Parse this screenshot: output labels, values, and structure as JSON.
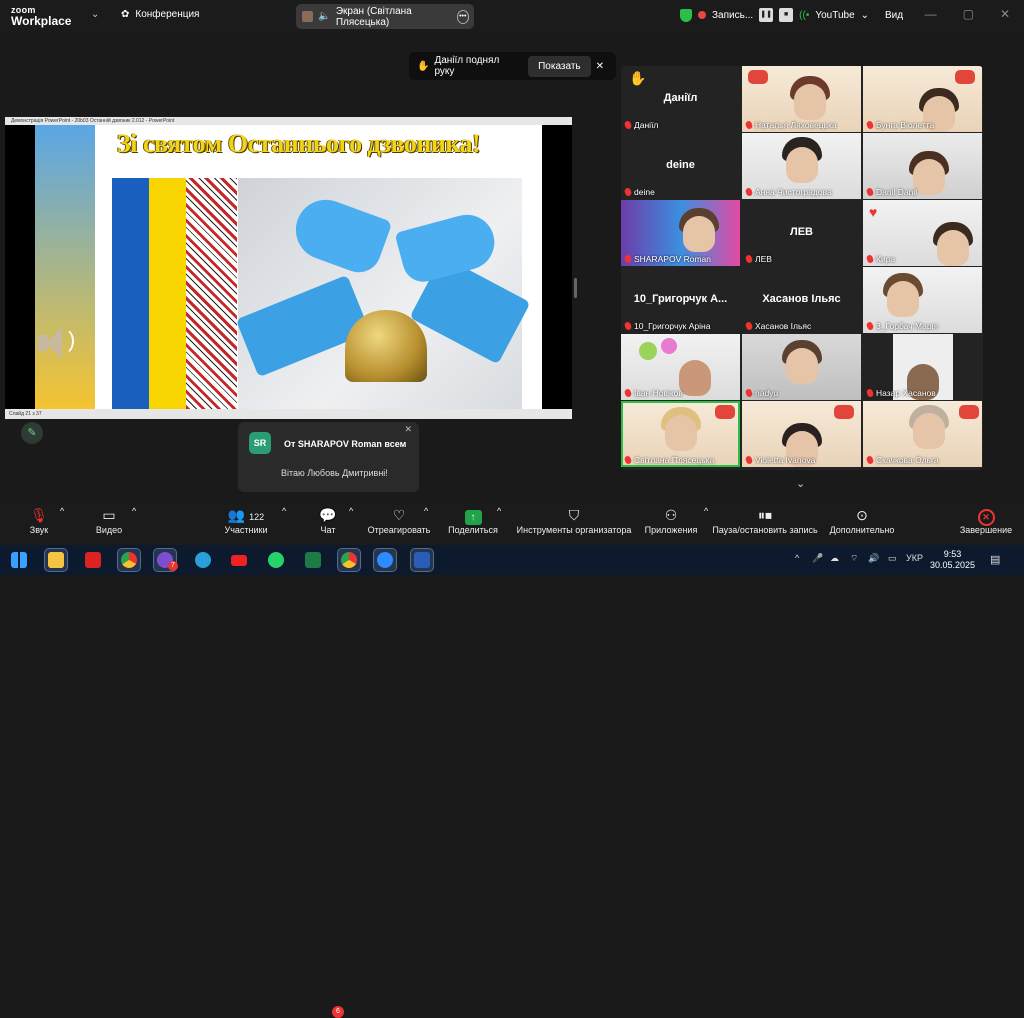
{
  "app": {
    "logo_line1": "zoom",
    "logo_line2": "Workplace",
    "meeting_title": "Конференция",
    "screen_label": "Экран (Світлана Плясецька)"
  },
  "topbar": {
    "recording": "Запись...",
    "youtube": "YouTube",
    "view": "Вид",
    "accent": "#2bbf4a"
  },
  "notification": {
    "text": "Даніїл поднял руку",
    "show": "Показать"
  },
  "slide": {
    "window_title": "Демонстрація PowerPoint - 20b03 Останній дзвоник 2.012 - PowerPoint",
    "title": "Зі святом Останнього дзвоника!",
    "status": "Слайд 21 з 37"
  },
  "chat": {
    "avatar": "SR",
    "from": "От SHARAPOV Roman всем",
    "message": "Вітаю Любовь Дмитривні!"
  },
  "participants": [
    {
      "big": "Даніїл",
      "name": "Даніїл"
    },
    {
      "name": "Наталья Ляховецька"
    },
    {
      "name": "Бунга Віолетта"
    },
    {
      "big": "deine",
      "name": "deine"
    },
    {
      "name": "Анна Чистоградова"
    },
    {
      "name": "Danil Danil"
    },
    {
      "name": "SHARAPOV Roman"
    },
    {
      "big": "ЛЕВ",
      "name": "ЛЕВ"
    },
    {
      "name": "Кира"
    },
    {
      "big": "10_Григорчук А...",
      "name": "10_Григорчук Аріна"
    },
    {
      "big": "Хасанов Ільяс",
      "name": "Хасанов Ільяс"
    },
    {
      "name": "3_Горбач Марія"
    },
    {
      "name": "Іван Новіков"
    },
    {
      "name": "nadyu"
    },
    {
      "name": "Назар Хасанов"
    },
    {
      "name": "Світлана Плясецька"
    },
    {
      "name": "Violetta Ivanova"
    },
    {
      "name": "Скачкова Ольга"
    }
  ],
  "toolbar": {
    "audio": "Звук",
    "video": "Видео",
    "participants": "Участники",
    "participants_count": "122",
    "chat": "Чат",
    "chat_badge": "6",
    "react": "Отреагировать",
    "share": "Поделиться",
    "host_tools": "Инструменты организатора",
    "apps": "Приложения",
    "pause_record": "Пауза/остановить запись",
    "more": "Дополнительно",
    "end": "Завершение"
  },
  "taskbar": {
    "lang": "УКР",
    "time": "9:53",
    "date": "30.05.2025",
    "badge_viber": "7"
  }
}
